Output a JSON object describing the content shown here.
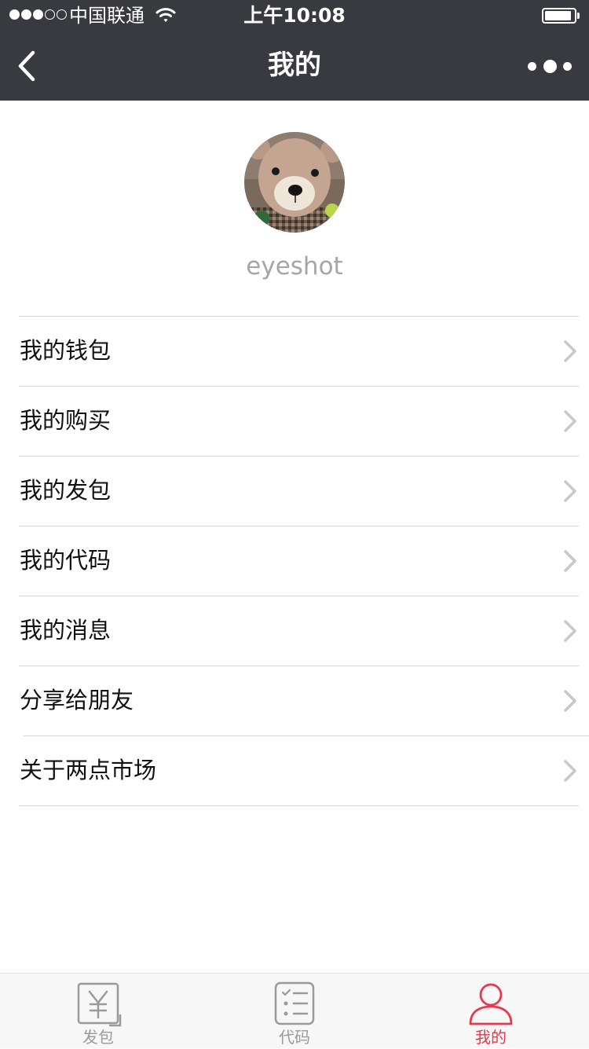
{
  "status_bar": {
    "carrier": "中国联通",
    "time": "上午10:08",
    "signal_bars_filled": 3,
    "signal_bars_total": 5,
    "battery_level": 0.92
  },
  "nav": {
    "back_icon": "chevron-left-icon",
    "title": "我的",
    "more_icon": "more-dots-icon"
  },
  "profile": {
    "avatar": "teddy-bear-avatar",
    "username": "eyeshot"
  },
  "menu": {
    "items": [
      {
        "label": "我的钱包"
      },
      {
        "label": "我的购买"
      },
      {
        "label": "我的发包"
      },
      {
        "label": "我的代码"
      },
      {
        "label": "我的消息"
      },
      {
        "label": "分享给朋友"
      },
      {
        "label": "关于两点市场"
      }
    ]
  },
  "tab_bar": {
    "tabs": [
      {
        "label": "发包",
        "icon": "yuan-icon",
        "active": false
      },
      {
        "label": "代码",
        "icon": "list-icon",
        "active": false
      },
      {
        "label": "我的",
        "icon": "user-icon",
        "active": true
      }
    ]
  },
  "colors": {
    "header_bg": "#393a3f",
    "accent": "#e5394f",
    "tab_inactive": "#9a9a9a",
    "divider": "#d6d6d6"
  }
}
